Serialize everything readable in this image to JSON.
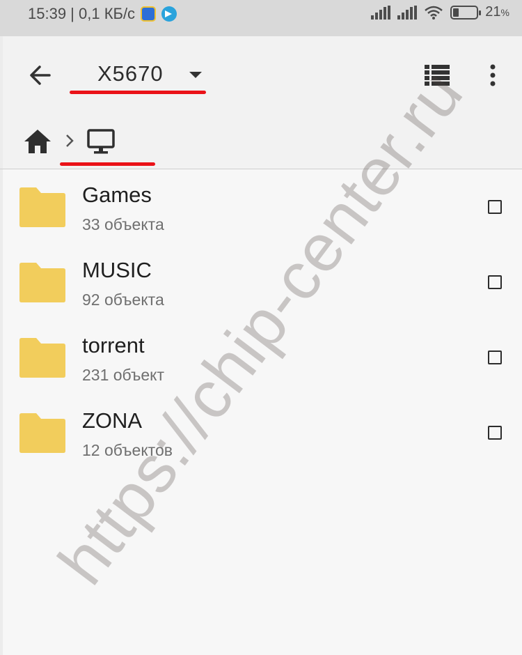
{
  "status_bar": {
    "time_speed": "15:39 | 0,1 КБ/с",
    "battery": "21",
    "battery_unit": "%"
  },
  "app_bar": {
    "title": "X5670"
  },
  "files": [
    {
      "name": "Games",
      "count": "33 объекта"
    },
    {
      "name": "MUSIC",
      "count": "92 объекта"
    },
    {
      "name": "torrent",
      "count": "231 объект"
    },
    {
      "name": "ZONA",
      "count": "12 объектов"
    }
  ],
  "watermark": "https://chip-center.ru",
  "colors": {
    "folder": "#f2cd5c",
    "highlight_underline": "#ea1218"
  },
  "icons": {
    "back": "arrow-left-icon",
    "dropdown": "triangle-down-icon",
    "view": "list-view-icon",
    "more": "more-vertical-icon",
    "home": "home-icon",
    "breadcrumb_separator": "chevron-right-icon",
    "computer": "monitor-icon",
    "folder": "folder-icon"
  }
}
